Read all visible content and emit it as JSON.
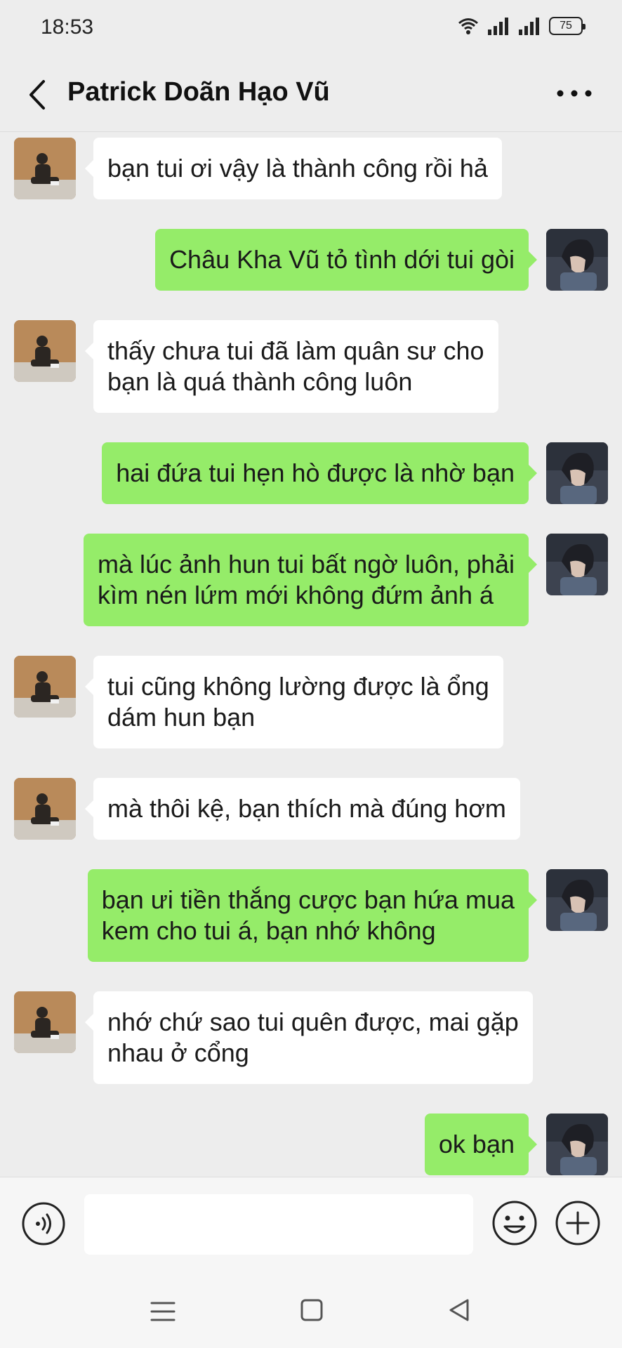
{
  "status_bar": {
    "time": "18:53",
    "battery": "75",
    "icons": [
      "wifi-icon",
      "signal-icon",
      "signal-icon",
      "battery-icon"
    ]
  },
  "header": {
    "title": "Patrick Doãn Hạo Vũ",
    "back_icon": "chevron-left-icon",
    "more_icon": "more-dots-icon"
  },
  "colors": {
    "background": "#ededed",
    "sent_bubble": "#95ec69",
    "received_bubble": "#ffffff"
  },
  "messages": [
    {
      "side": "left",
      "text": "bạn tui ơi vậy là thành công rồi hả"
    },
    {
      "side": "right",
      "text": "Châu Kha Vũ tỏ tình dới tui gòi"
    },
    {
      "side": "left",
      "text": "thấy chưa tui đã làm quân sư cho\nbạn là quá thành công luôn"
    },
    {
      "side": "right",
      "text": "hai đứa tui hẹn hò được là nhờ bạn"
    },
    {
      "side": "right",
      "text": "mà lúc ảnh hun tui bất ngờ luôn, phải\nkìm nén lứm mới không đứm ảnh á"
    },
    {
      "side": "left",
      "text": "tui cũng không lường được là ổng\ndám hun bạn"
    },
    {
      "side": "left",
      "text": "mà thôi kệ, bạn thích mà đúng hơm"
    },
    {
      "side": "right",
      "text": "bạn ưi tiền thắng cược bạn hứa mua\nkem cho tui á, bạn nhớ không"
    },
    {
      "side": "left",
      "text": "nhớ chứ sao tui quên được, mai gặp\nnhau ở cổng"
    },
    {
      "side": "right",
      "text": "ok bạn"
    }
  ],
  "input_bar": {
    "value": "",
    "voice_icon": "voice-icon",
    "emoji_icon": "emoji-icon",
    "add_icon": "plus-circle-icon"
  },
  "nav_bar": {
    "icons": [
      "menu-icon",
      "home-square-icon",
      "back-triangle-icon"
    ]
  }
}
